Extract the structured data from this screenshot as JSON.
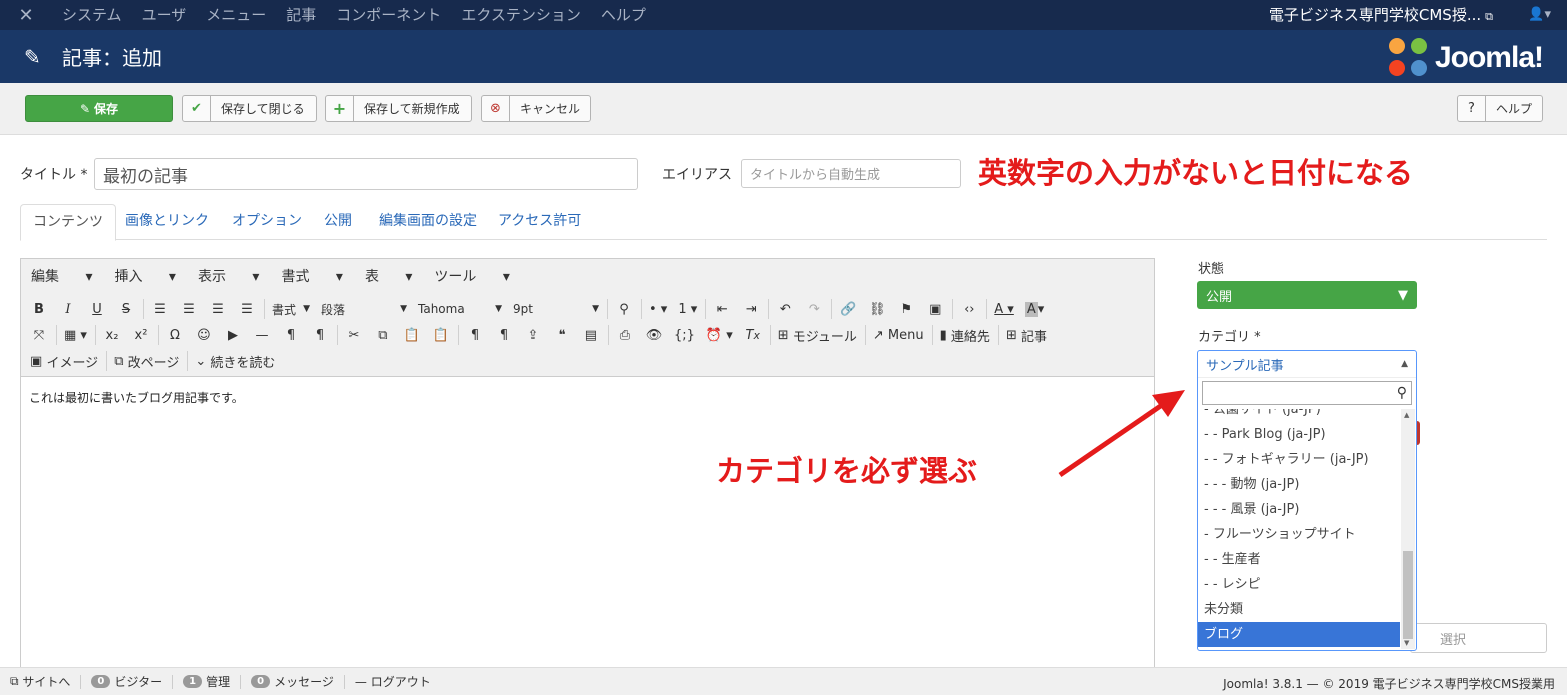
{
  "navbar": {
    "menu": [
      "システム",
      "ユーザ",
      "メニュー",
      "記事",
      "コンポーネント",
      "エクステンション",
      "ヘルプ"
    ],
    "site_name": "電子ビジネス専門学校CMS授..."
  },
  "header": {
    "title": "記事：追加",
    "brand": "Joomla!"
  },
  "toolbar": {
    "save": "保存",
    "save_close": "保存して閉じる",
    "save_new": "保存して新規作成",
    "cancel": "キャンセル",
    "help": "ヘルプ"
  },
  "form": {
    "title_label": "タイトル",
    "title_value": "最初の記事",
    "alias_label": "エイリアス",
    "alias_placeholder": "タイトルから自動生成"
  },
  "annotations": {
    "alias_note": "英数字の入力がないと日付になる",
    "category_note": "カテゴリを必ず選ぶ"
  },
  "tabs": [
    "コンテンツ",
    "画像とリンク",
    "オプション",
    "公開",
    "編集画面の設定",
    "アクセス許可"
  ],
  "editor": {
    "menubar": [
      "編集",
      "挿入",
      "表示",
      "書式",
      "表",
      "ツール"
    ],
    "format_select": "書式",
    "paragraph_select": "段落",
    "font_select": "Tahoma",
    "size_select": "9pt",
    "btn_module": "モジュール",
    "btn_menu": "Menu",
    "btn_contact": "連絡先",
    "btn_article": "記事",
    "btn_image": "イメージ",
    "btn_pagebreak": "改ページ",
    "btn_readmore": "続きを読む",
    "content": "これは最初に書いたブログ用記事です。"
  },
  "sidebar": {
    "status_label": "状態",
    "status_value": "公開",
    "category_label": "カテゴリ",
    "category_selected": "サンプル記事",
    "category_options": [
      "- 公園サイト (ja-JP)",
      "- - Park Blog (ja-JP)",
      "- - フォトギャラリー (ja-JP)",
      "- - - 動物 (ja-JP)",
      "- - - 風景 (ja-JP)",
      "- フルーツショップサイト",
      "- - 生産者",
      "- - レシピ",
      "未分類",
      "ブログ"
    ],
    "behind_input_text": "選択"
  },
  "statusbar": {
    "site": "サイトへ",
    "visitors_count": "0",
    "visitors": "ビジター",
    "admin_count": "1",
    "admin": "管理",
    "messages_count": "0",
    "messages": "メッセージ",
    "logout": "ログアウト",
    "copyright": "Joomla! 3.8.1 — © 2019 電子ビジネス専門学校CMS授業用"
  }
}
